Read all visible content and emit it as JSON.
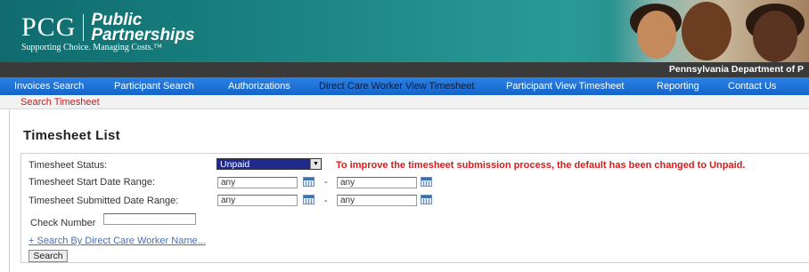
{
  "header": {
    "logo_pcg": "PCG",
    "logo_public": "Public",
    "logo_partnerships": "Partnerships",
    "tagline": "Supporting Choice. Managing Costs.™",
    "state_label": "Pennsylvania Department of P",
    "colors": {
      "banner": "#1f8a88",
      "state_bar": "#3a3a3a"
    }
  },
  "nav": {
    "items": [
      {
        "label": "Invoices Search"
      },
      {
        "label": "Participant Search"
      },
      {
        "label": "Authorizations"
      },
      {
        "label": "Direct Care Worker View Timesheet",
        "active": true
      },
      {
        "label": "Participant View Timesheet"
      },
      {
        "label": "Reporting"
      },
      {
        "label": "Contact Us"
      }
    ],
    "colors": {
      "bar": "#1e73d8",
      "text": "#ffffff",
      "active_text": "#101a3a"
    }
  },
  "subnav": {
    "label": "Search Timesheet",
    "color": "#c02020"
  },
  "page": {
    "title": "Timesheet List"
  },
  "form": {
    "status_label": "Timesheet Status:",
    "status_value": "Unpaid",
    "notice": "To improve the timesheet submission process, the default has been changed to Unpaid.",
    "notice_color": "#d81c1c",
    "start_label": "Timesheet Start Date Range:",
    "start_from": "any",
    "start_to": "any",
    "submitted_label": "Timesheet Submitted Date Range:",
    "submitted_from": "any",
    "submitted_to": "any",
    "range_separator": "-",
    "check_label": "Check Number",
    "check_value": "",
    "dcw_link": "+ Search By Direct Care Worker Name...",
    "search_button": "Search"
  }
}
